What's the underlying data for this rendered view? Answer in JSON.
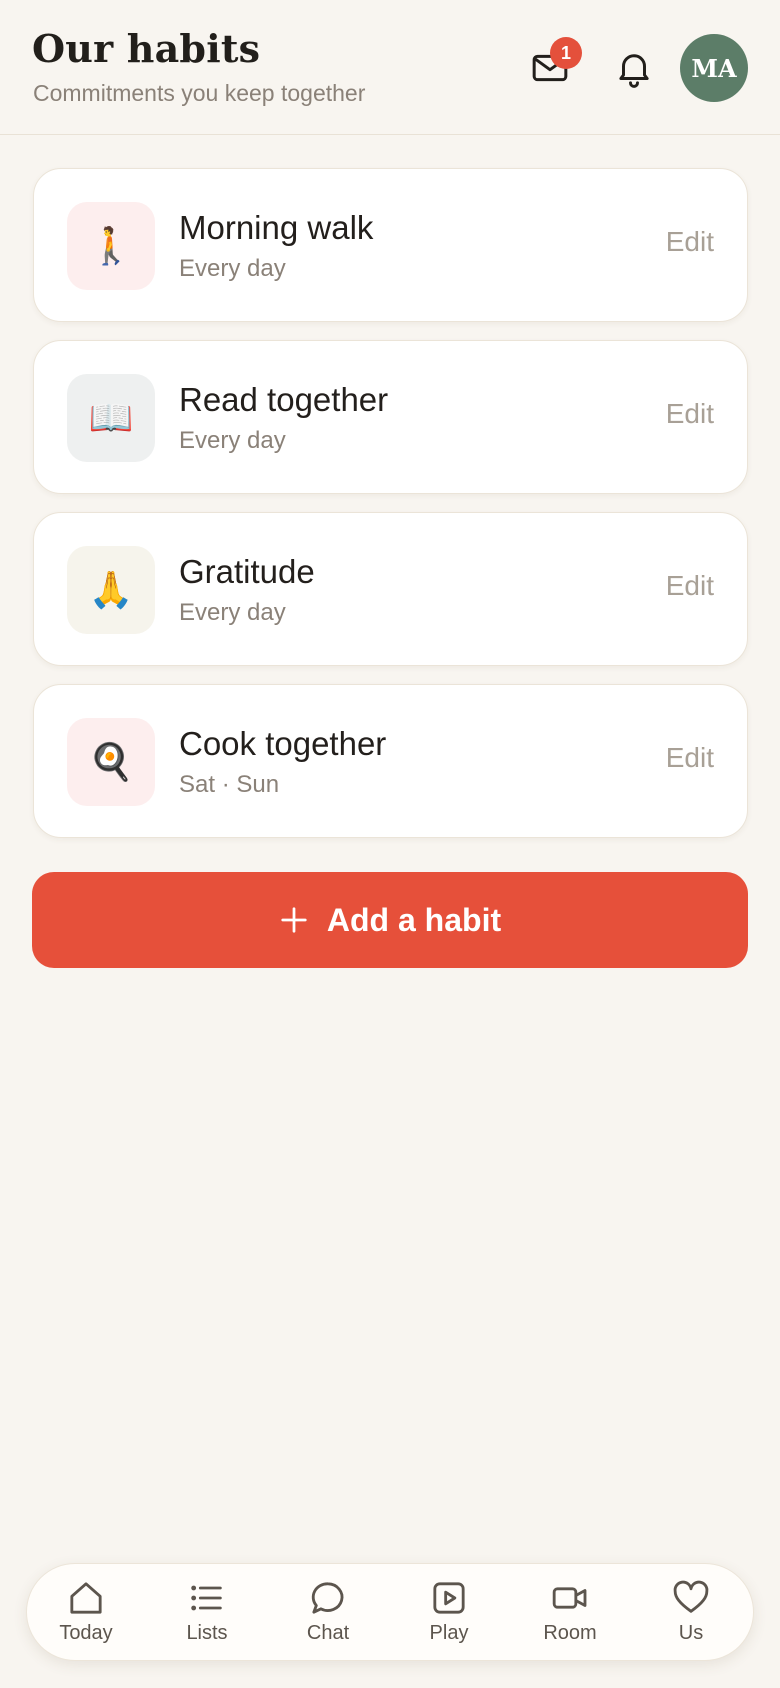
{
  "header": {
    "title": "Our habits",
    "subtitle": "Commitments you keep together",
    "mail_badge": "1",
    "avatar_initials": "MA"
  },
  "habits": [
    {
      "name": "Morning walk",
      "schedule": "Every day",
      "emoji": "🚶",
      "icon_bg": "#fdeeee",
      "edit_label": "Edit"
    },
    {
      "name": "Read together",
      "schedule": "Every day",
      "emoji": "📖",
      "icon_bg": "#eef0f0",
      "edit_label": "Edit"
    },
    {
      "name": "Gratitude",
      "schedule": "Every day",
      "emoji": "🙏",
      "icon_bg": "#f6f4ec",
      "edit_label": "Edit"
    },
    {
      "name": "Cook together",
      "schedule": "Sat · Sun",
      "emoji": "🍳",
      "icon_bg": "#fdeeee",
      "edit_label": "Edit"
    }
  ],
  "add_button": {
    "label": "Add a habit",
    "icon": "plus-icon"
  },
  "nav": {
    "items": [
      {
        "label": "Today",
        "icon": "home-icon"
      },
      {
        "label": "Lists",
        "icon": "list-icon"
      },
      {
        "label": "Chat",
        "icon": "chat-bubble-icon"
      },
      {
        "label": "Play",
        "icon": "play-icon"
      },
      {
        "label": "Room",
        "icon": "video-camera-icon"
      },
      {
        "label": "Us",
        "icon": "heart-icon"
      }
    ]
  },
  "colors": {
    "background": "#f8f5f0",
    "accent": "#e6503a",
    "avatar": "#5c7d68",
    "badge": "#e4503b"
  }
}
